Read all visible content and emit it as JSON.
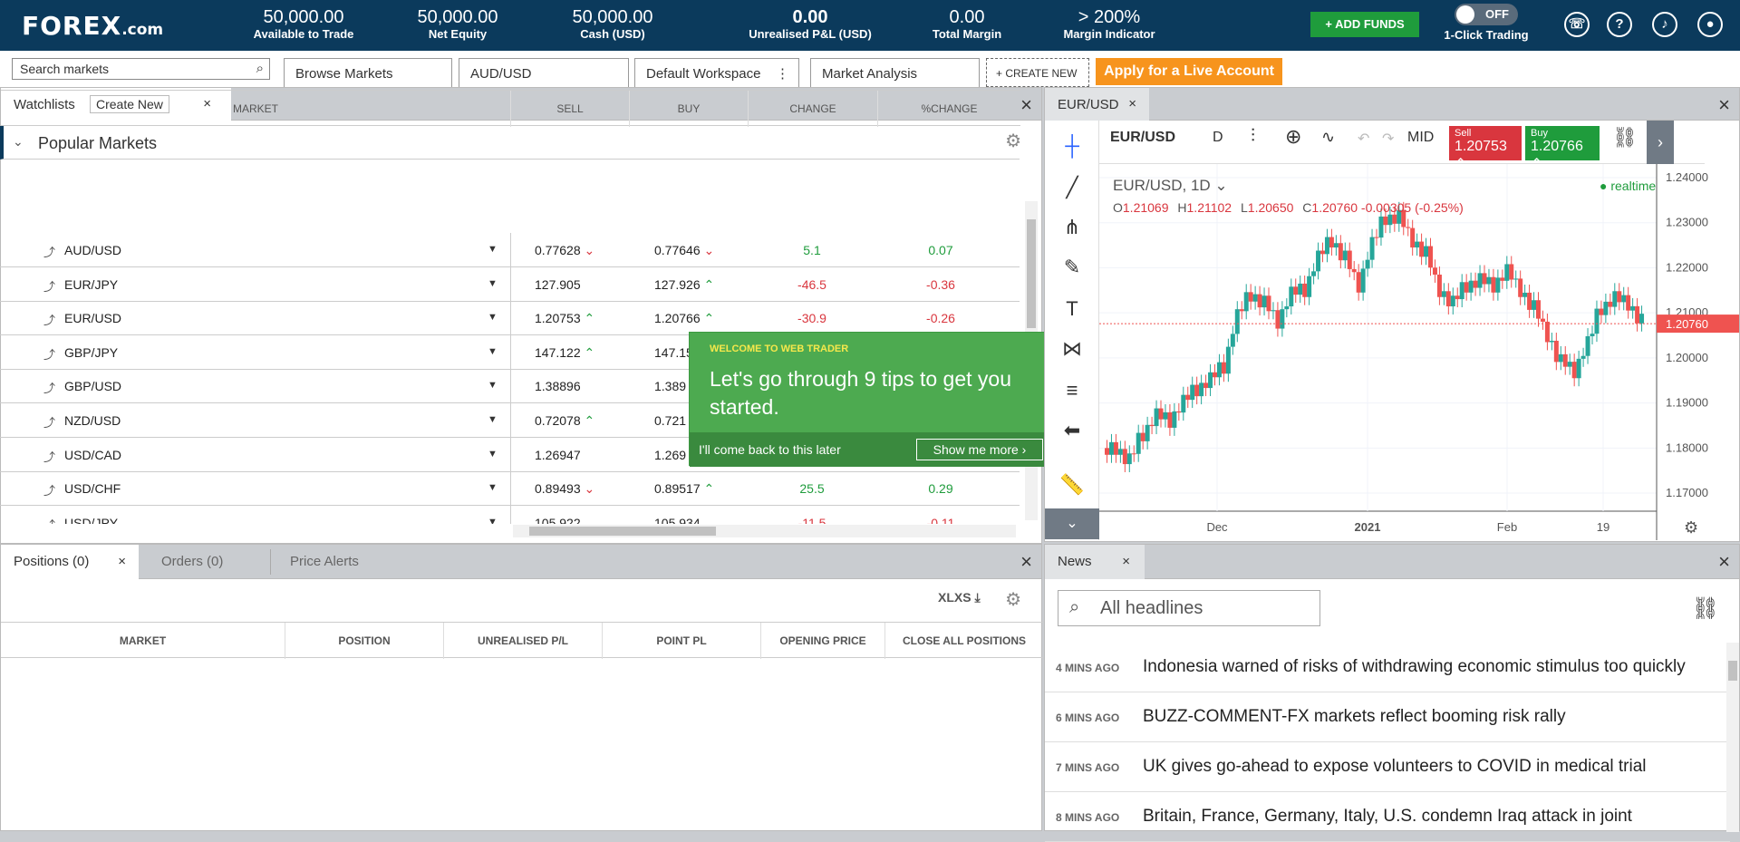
{
  "header": {
    "logo": "FOREX",
    "logo_suffix": ".com",
    "stats": [
      {
        "value": "50,000.00",
        "label": "Available to Trade"
      },
      {
        "value": "50,000.00",
        "label": "Net Equity"
      },
      {
        "value": "50,000.00",
        "label": "Cash (USD)"
      },
      {
        "value": "0.00",
        "label": "Unrealised P&L (USD)"
      },
      {
        "value": "0.00",
        "label": "Total Margin"
      },
      {
        "value": "> 200%",
        "label": "Margin Indicator"
      }
    ],
    "add_funds": "+ ADD FUNDS",
    "one_click": {
      "state": "OFF",
      "label": "1-Click Trading"
    },
    "icons": [
      "phone-icon",
      "help-icon",
      "bell-icon",
      "user-icon"
    ]
  },
  "nav": {
    "search_placeholder": "Search markets",
    "tabs": [
      "Browse Markets",
      "AUD/USD",
      "Default Workspace",
      "Market Analysis"
    ],
    "create_new": "+ CREATE NEW",
    "live_account": "Apply for a Live Account"
  },
  "watchlists": {
    "tab": "Watchlists",
    "create_new": "Create New",
    "columns": [
      "MARKET",
      "SELL",
      "BUY",
      "CHANGE",
      "%CHANGE"
    ],
    "group": "Popular Markets",
    "rows": [
      {
        "market": "AUD/USD",
        "sell": "0.77628",
        "sell_dir": "down",
        "buy": "0.77646",
        "buy_dir": "down",
        "change": "5.1",
        "pchange": "0.07",
        "trend": "up"
      },
      {
        "market": "EUR/JPY",
        "sell": "127.905",
        "sell_dir": "",
        "buy": "127.926",
        "buy_dir": "up",
        "change": "-46.5",
        "pchange": "-0.36",
        "trend": "down"
      },
      {
        "market": "EUR/USD",
        "sell": "1.20753",
        "sell_dir": "up",
        "buy": "1.20766",
        "buy_dir": "up",
        "change": "-30.9",
        "pchange": "-0.26",
        "trend": "down"
      },
      {
        "market": "GBP/JPY",
        "sell": "147.122",
        "sell_dir": "up",
        "buy": "147.15",
        "buy_dir": "",
        "change": "",
        "pchange": "",
        "trend": ""
      },
      {
        "market": "GBP/USD",
        "sell": "1.38896",
        "sell_dir": "",
        "buy": "1.389",
        "buy_dir": "",
        "change": "",
        "pchange": "",
        "trend": ""
      },
      {
        "market": "NZD/USD",
        "sell": "0.72078",
        "sell_dir": "up",
        "buy": "0.721",
        "buy_dir": "",
        "change": "",
        "pchange": "",
        "trend": ""
      },
      {
        "market": "USD/CAD",
        "sell": "1.26947",
        "sell_dir": "",
        "buy": "1.269",
        "buy_dir": "",
        "change": "",
        "pchange": "",
        "trend": ""
      },
      {
        "market": "USD/CHF",
        "sell": "0.89493",
        "sell_dir": "down",
        "buy": "0.89517",
        "buy_dir": "up",
        "change": "25.5",
        "pchange": "0.29",
        "trend": "up"
      },
      {
        "market": "USD/JPY",
        "sell": "105.922",
        "sell_dir": "",
        "buy": "105.934",
        "buy_dir": "",
        "change": "-11.5",
        "pchange": "-0.11",
        "trend": "down"
      }
    ]
  },
  "tooltip": {
    "heading": "WELCOME TO WEB TRADER",
    "body": "Let's go through 9 tips to get you started.",
    "later": "I'll come back to this later",
    "more": "Show me more ›"
  },
  "chart": {
    "tab": "EUR/USD",
    "symbol": "EUR/USD",
    "interval": "D",
    "mid": "MID",
    "sell_label": "Sell",
    "sell_price": "1.20753",
    "buy_label": "Buy",
    "buy_price": "1.20766",
    "legend_title": "EUR/USD, 1D",
    "ohlc": {
      "o": "1.21069",
      "h": "1.21102",
      "l": "1.20650",
      "c": "1.20760",
      "chg": "-0.00305 (-0.25%)"
    },
    "realtime": "realtime",
    "price_tag": "1.20760",
    "accent_up": "#26a69a",
    "accent_down": "#ef5350"
  },
  "chart_data": {
    "type": "line",
    "title": "EUR/USD, 1D",
    "xlabel": "",
    "ylabel": "",
    "x_ticks": [
      "Dec",
      "2021",
      "Feb",
      "19"
    ],
    "y_ticks": [
      "1.24000",
      "1.23000",
      "1.22000",
      "1.21000",
      "1.20000",
      "1.19000",
      "1.18000",
      "1.17000"
    ],
    "ylim": [
      1.168,
      1.241
    ],
    "series": [
      {
        "values": [
          1.18,
          1.177,
          1.183,
          1.187,
          1.186,
          1.19,
          1.193,
          1.195,
          1.198,
          1.209,
          1.214,
          1.212,
          1.208,
          1.214,
          1.215,
          1.222,
          1.226,
          1.222,
          1.216,
          1.225,
          1.231,
          1.231,
          1.226,
          1.223,
          1.215,
          1.212,
          1.216,
          1.217,
          1.216,
          1.219,
          1.215,
          1.211,
          1.205,
          1.199,
          1.197,
          1.203,
          1.211,
          1.213,
          1.212,
          1.208
        ]
      }
    ]
  },
  "positions": {
    "tabs": [
      "Positions (0)",
      "Orders (0)",
      "Price Alerts"
    ],
    "xlxs": "XLXS",
    "columns": [
      "MARKET",
      "POSITION",
      "UNREALISED P/L",
      "POINT PL",
      "OPENING PRICE",
      "CLOSE ALL POSITIONS"
    ]
  },
  "news": {
    "tab": "News",
    "search_placeholder": "All headlines",
    "items": [
      {
        "age": "4 MINS AGO",
        "headline": "Indonesia warned of risks of withdrawing economic stimulus too quickly"
      },
      {
        "age": "6 MINS AGO",
        "headline": "BUZZ-COMMENT-FX markets reflect booming risk rally"
      },
      {
        "age": "7 MINS AGO",
        "headline": "UK gives go-ahead to expose volunteers to COVID in medical trial"
      },
      {
        "age": "8 MINS AGO",
        "headline": "Britain, France, Germany, Italy, U.S. condemn Iraq attack in joint"
      }
    ]
  }
}
